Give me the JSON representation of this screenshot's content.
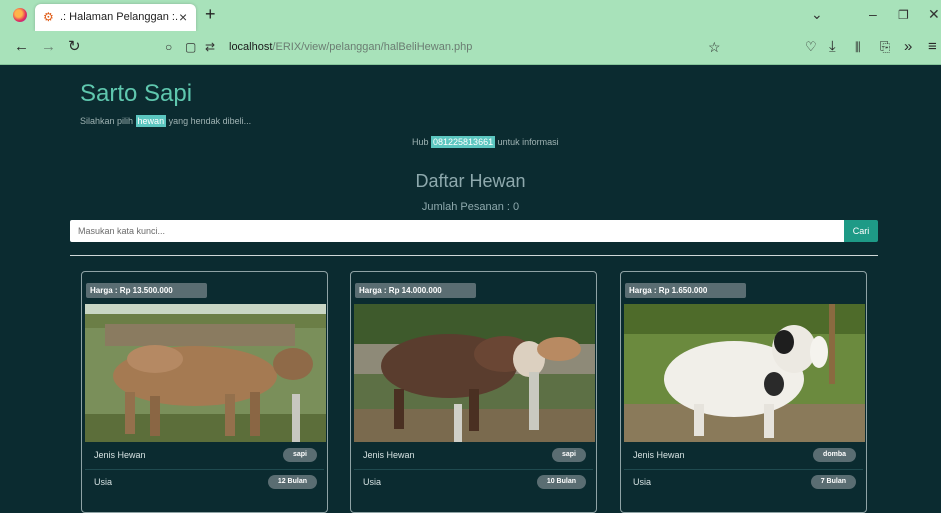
{
  "browser": {
    "tab_title": ".: Halaman Pelanggan :.",
    "url_host": "localhost",
    "url_path": "/ERIX/view/pelanggan/halBeliHewan.php"
  },
  "header": {
    "site_title": "Sarto Sapi",
    "subtitle_before": "Silahkan pilih ",
    "subtitle_highlight": "hewan",
    "subtitle_after": " yang hendak dibeli...",
    "contact_before": "Hub ",
    "contact_phone": "081225813661",
    "contact_after": " untuk informasi"
  },
  "main": {
    "list_title": "Daftar Hewan",
    "order_count": "Jumlah Pesanan : 0",
    "search_placeholder": "Masukan kata kunci...",
    "search_button": "Cari"
  },
  "animals": [
    {
      "price": "Harga : Rp 13.500.000",
      "type_label": "Jenis Hewan",
      "type": "sapi",
      "age_label": "Usia",
      "age": "12  Bulan",
      "image": "brown-cattle-photo"
    },
    {
      "price": "Harga : Rp 14.000.000",
      "type_label": "Jenis Hewan",
      "type": "sapi",
      "age_label": "Usia",
      "age": "10  Bulan",
      "image": "dark-cattle-photo"
    },
    {
      "price": "Harga : Rp 1.650.000",
      "type_label": "Jenis Hewan",
      "type": "domba",
      "age_label": "Usia",
      "age": "7  Bulan",
      "image": "white-sheep-photo"
    }
  ],
  "colors": {
    "accent": "#5fc7ae",
    "background": "#0b2b30",
    "chrome": "#a8e2ba",
    "button": "#1e9a86"
  }
}
